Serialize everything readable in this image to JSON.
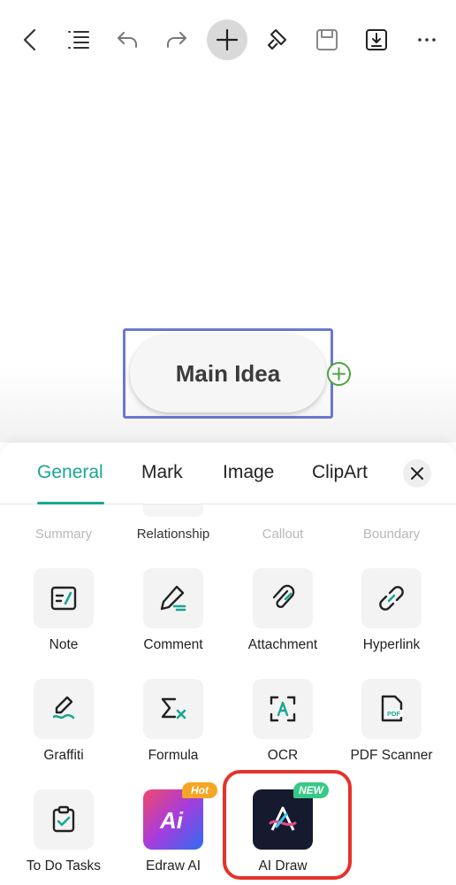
{
  "toolbar": {
    "buttons": [
      {
        "name": "back-button",
        "icon": "chevron-left-icon"
      },
      {
        "name": "outline-button",
        "icon": "outline-list-icon"
      },
      {
        "name": "undo-button",
        "icon": "undo-icon"
      },
      {
        "name": "redo-button",
        "icon": "redo-icon"
      },
      {
        "name": "insert-button",
        "icon": "plus-icon"
      },
      {
        "name": "format-painter-button",
        "icon": "paint-brush-icon"
      },
      {
        "name": "save-button",
        "icon": "save-icon"
      },
      {
        "name": "export-button",
        "icon": "download-icon"
      },
      {
        "name": "more-button",
        "icon": "more-icon"
      }
    ]
  },
  "canvas": {
    "main_node": "Main Idea",
    "colors": {
      "selection": "#6b78cf",
      "add_node": "#4fa340"
    }
  },
  "panel": {
    "tabs": [
      "General",
      "Mark",
      "Image",
      "ClipArt"
    ],
    "active_tab": "General",
    "accent_color": "#1aa693",
    "faded_row": [
      "Summary",
      "Relationship",
      "Callout",
      "Boundary"
    ],
    "items": [
      {
        "label": "Note",
        "icon": "note-icon"
      },
      {
        "label": "Comment",
        "icon": "comment-pen-icon"
      },
      {
        "label": "Attachment",
        "icon": "paperclip-icon"
      },
      {
        "label": "Hyperlink",
        "icon": "link-icon"
      },
      {
        "label": "Graffiti",
        "icon": "graffiti-pen-icon"
      },
      {
        "label": "Formula",
        "icon": "sigma-icon"
      },
      {
        "label": "OCR",
        "icon": "ocr-scan-icon"
      },
      {
        "label": "PDF Scanner",
        "icon": "pdf-icon"
      },
      {
        "label": "To Do Tasks",
        "icon": "clipboard-check-icon"
      },
      {
        "label": "Edraw AI",
        "icon": "edraw-ai-icon",
        "badge": "Hot"
      },
      {
        "label": "AI Draw",
        "icon": "ai-draw-icon",
        "badge": "NEW"
      }
    ]
  }
}
